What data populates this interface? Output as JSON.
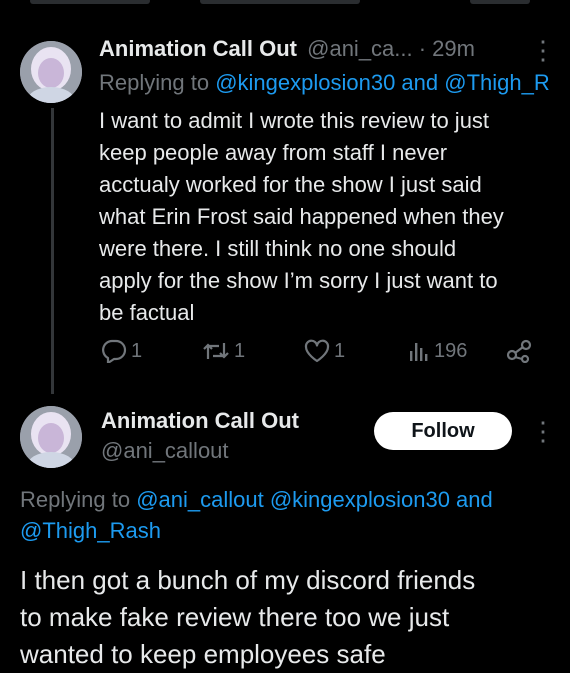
{
  "tweet1": {
    "display_name": "Animation Call Out",
    "handle_time": "@ani_ca... · 29m",
    "more": "⋮",
    "replying_prefix": "Replying to ",
    "replying_handles": "@kingexplosion30 and @Thigh_R",
    "lines": [
      "I want to admit I wrote this review to just",
      "keep people away from staff I never",
      "acctualy worked for the show I just said",
      "what Erin Frost said happened when they",
      "were there. I still think no one should",
      "apply for the show I’m sorry I just want to",
      "be factual"
    ],
    "actions": {
      "reply_count": "1",
      "retweet_count": "1",
      "like_count": "1",
      "views_count": "196"
    }
  },
  "tweet2": {
    "display_name": "Animation Call Out",
    "handle": "@ani_callout",
    "follow_label": "Follow",
    "more": "⋮",
    "replying_prefix": "Replying to ",
    "replying_line1_handles": "@ani_callout @kingexplosion30",
    "replying_line1_and": " and",
    "replying_line2_handle": "@Thigh_Rash",
    "lines": [
      "I then got a bunch of my discord friends",
      "to make fake review there too we just",
      "wanted to keep employees safe"
    ]
  },
  "colors": {
    "background": "#000000",
    "text": "#e7e9ea",
    "muted": "#71767b",
    "link": "#1d9bf0",
    "follow_bg": "#ffffff"
  }
}
